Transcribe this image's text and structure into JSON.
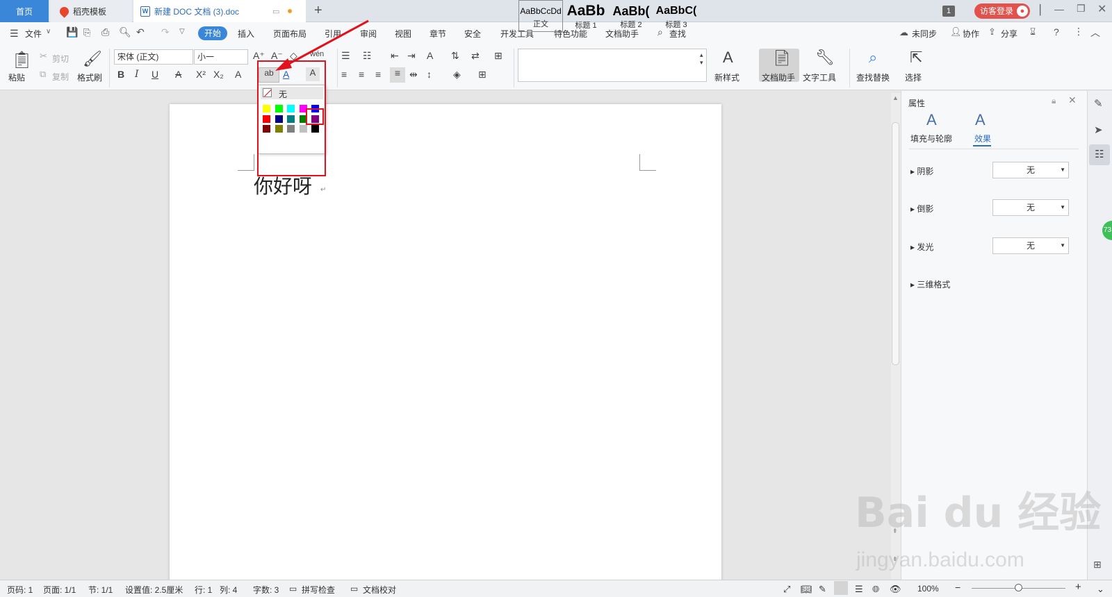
{
  "tabs": {
    "home": "首页",
    "template": "稻壳模板",
    "document": "新建 DOC 文档 (3).doc",
    "new_tab": "+"
  },
  "titlebar": {
    "badge": "1",
    "login": "访客登录"
  },
  "menu": {
    "file": "文件",
    "items": [
      "开始",
      "插入",
      "页面布局",
      "引用",
      "审阅",
      "视图",
      "章节",
      "安全",
      "开发工具",
      "特色功能",
      "文档助手"
    ],
    "search": "查找",
    "sync": "未同步",
    "collab": "协作",
    "share": "分享"
  },
  "ribbon": {
    "paste": "粘贴",
    "cut": "剪切",
    "copy": "复制",
    "format_painter": "格式刷",
    "font_name": "宋体 (正文)",
    "font_size": "小一",
    "new_style": "新样式",
    "doc_helper": "文档助手",
    "text_tool": "文字工具",
    "find_replace": "查找替换",
    "select": "选择"
  },
  "styles": [
    {
      "preview": "AaBbCcDd",
      "name": "正文"
    },
    {
      "preview": "AaBb",
      "name": "标题 1"
    },
    {
      "preview": "AaBb(",
      "name": "标题 2"
    },
    {
      "preview": "AaBbC(",
      "name": "标题 3"
    }
  ],
  "highlight_dropdown": {
    "none_label": "无",
    "colors": [
      "#ffff00",
      "#00ff00",
      "#00ffff",
      "#ff00ff",
      "#0000ff",
      "#ff0000",
      "#000080",
      "#008080",
      "#008000",
      "#800080",
      "#800000",
      "#808000",
      "#808080",
      "#c0c0c0",
      "#000000"
    ],
    "selected_color": "#800080"
  },
  "document": {
    "text": "你好呀"
  },
  "panel": {
    "title": "属性",
    "tabs": [
      "填充与轮廓",
      "效果"
    ],
    "active_tab": "效果",
    "rows": [
      {
        "label": "阴影",
        "value": "无"
      },
      {
        "label": "倒影",
        "value": "无"
      },
      {
        "label": "发光",
        "value": "无"
      },
      {
        "label": "三维格式",
        "value": ""
      }
    ]
  },
  "status": {
    "page_num": "页码: 1",
    "pages": "页面: 1/1",
    "section": "节: 1/1",
    "setting": "设置值: 2.5厘米",
    "row": "行: 1",
    "col": "列: 4",
    "words": "字数: 3",
    "spell": "拼写检查",
    "proof": "文档校对",
    "zoom": "100%"
  },
  "float_badge": "73",
  "watermark": {
    "brand": "Bai du 经验",
    "url": "jingyan.baidu.com"
  },
  "colors": {
    "accent": "#3a86d9",
    "annotation": "#e3111c",
    "login": "#e2524d"
  }
}
